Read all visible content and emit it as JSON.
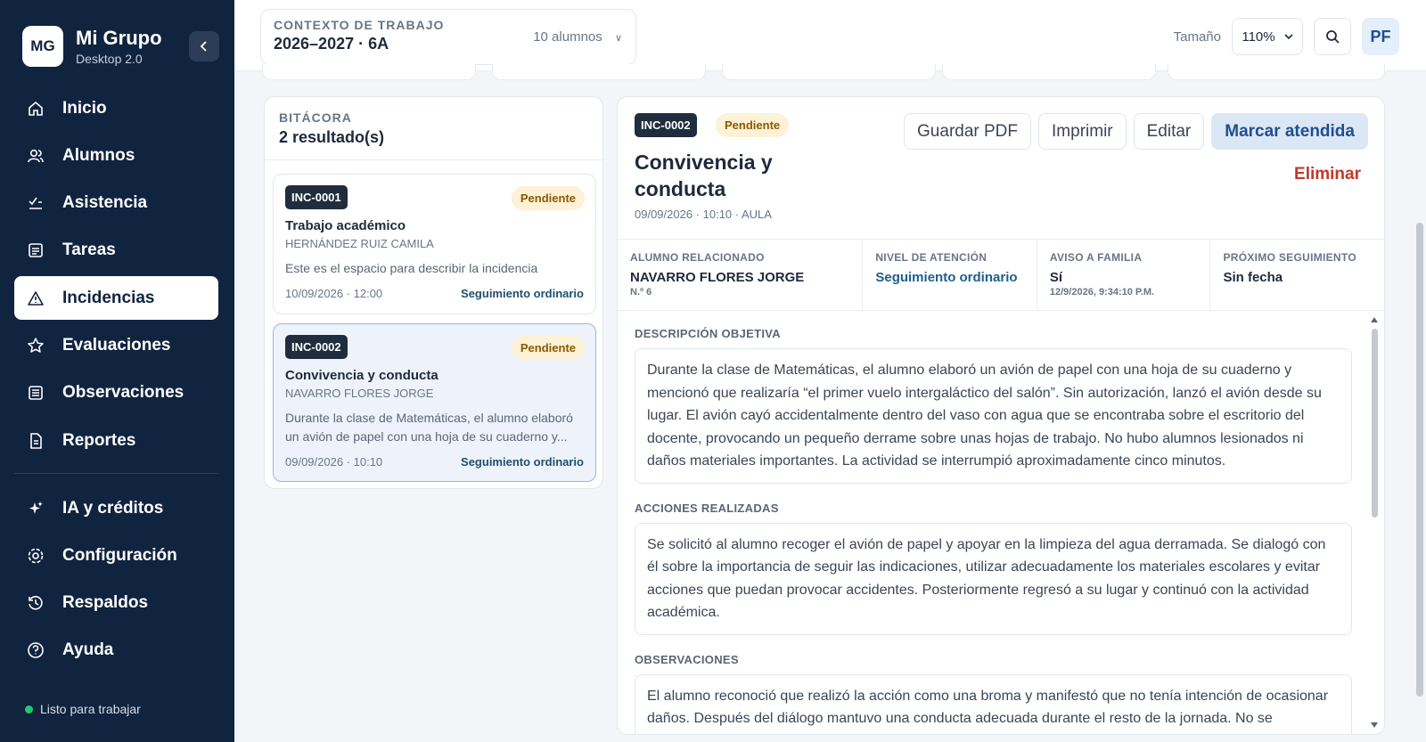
{
  "brand": {
    "logo": "MG",
    "title": "Mi Grupo",
    "subtitle": "Desktop 2.0"
  },
  "sidebar": {
    "items": [
      {
        "label": "Inicio",
        "icon": "home-icon"
      },
      {
        "label": "Alumnos",
        "icon": "users-icon"
      },
      {
        "label": "Asistencia",
        "icon": "checklist-icon"
      },
      {
        "label": "Tareas",
        "icon": "tasks-icon"
      },
      {
        "label": "Incidencias",
        "icon": "warning-icon",
        "active": true
      },
      {
        "label": "Evaluaciones",
        "icon": "star-icon"
      },
      {
        "label": "Observaciones",
        "icon": "notes-icon"
      },
      {
        "label": "Reportes",
        "icon": "report-icon"
      }
    ],
    "secondary": [
      {
        "label": "IA y créditos",
        "icon": "sparkle-icon"
      },
      {
        "label": "Configuración",
        "icon": "gear-icon"
      },
      {
        "label": "Respaldos",
        "icon": "history-icon"
      },
      {
        "label": "Ayuda",
        "icon": "help-icon"
      }
    ],
    "status": "Listo para trabajar"
  },
  "topbar": {
    "context_label": "CONTEXTO DE TRABAJO",
    "context_value": "2026–2027 · 6A",
    "context_count": "10 alumnos",
    "size_label": "Tamaño",
    "size_value": "110%",
    "avatar": "PF"
  },
  "log": {
    "title": "BITÁCORA",
    "count": "2 resultado(s)",
    "cards": [
      {
        "id": "INC-0001",
        "status": "Pendiente",
        "title": "Trabajo académico",
        "student": "HERNÁNDEZ RUIZ CAMILA",
        "desc": "Este es el espacio para describir la incidencia",
        "date": "10/09/2026 · 12:00",
        "level": "Seguimiento ordinario"
      },
      {
        "id": "INC-0002",
        "status": "Pendiente",
        "title": "Convivencia y conducta",
        "student": "NAVARRO FLORES JORGE",
        "desc": "Durante la clase de Matemáticas, el alumno elaboró un avión de papel con una hoja de su cuaderno y...",
        "date": "09/09/2026 · 10:10",
        "level": "Seguimiento ordinario"
      }
    ]
  },
  "detail": {
    "id": "INC-0002",
    "status": "Pendiente",
    "title": "Convivencia y conducta",
    "meta": "09/09/2026 · 10:10 · AULA",
    "actions": {
      "pdf": "Guardar PDF",
      "print": "Imprimir",
      "edit": "Editar",
      "attend": "Marcar atendida",
      "delete": "Eliminar"
    },
    "info": {
      "student_label": "ALUMNO RELACIONADO",
      "student_value": "NAVARRO FLORES JORGE",
      "student_sub": "N.º 6",
      "level_label": "NIVEL DE ATENCIÓN",
      "level_value": "Seguimiento ordinario",
      "family_label": "AVISO A FAMILIA",
      "family_value": "Sí",
      "family_sub": "12/9/2026, 9:34:10 P.M.",
      "next_label": "PRÓXIMO SEGUIMIENTO",
      "next_value": "Sin fecha"
    },
    "sections": {
      "desc_label": "DESCRIPCIÓN OBJETIVA",
      "desc_text": "Durante la clase de Matemáticas, el alumno elaboró un avión de papel con una hoja de su cuaderno y mencionó que realizaría “el primer vuelo intergaláctico del salón”. Sin autorización, lanzó el avión desde su lugar. El avión cayó accidentalmente dentro del vaso con agua que se encontraba sobre el escritorio del docente, provocando un pequeño derrame sobre unas hojas de trabajo. No hubo alumnos lesionados ni daños materiales importantes. La actividad se interrumpió aproximadamente cinco minutos.",
      "actions_label": "ACCIONES REALIZADAS",
      "actions_text": "Se solicitó al alumno recoger el avión de papel y apoyar en la limpieza del agua derramada. Se dialogó con él sobre la importancia de seguir las indicaciones, utilizar adecuadamente los materiales escolares y evitar acciones que puedan provocar accidentes. Posteriormente regresó a su lugar y continuó con la actividad académica.",
      "obs_label": "OBSERVACIONES",
      "obs_text": "El alumno reconoció que realizó la acción como una broma y manifestó que no tenía intención de ocasionar daños. Después del diálogo mantuvo una conducta adecuada durante el resto de la jornada. No se registraron incidentes adicionales."
    }
  }
}
